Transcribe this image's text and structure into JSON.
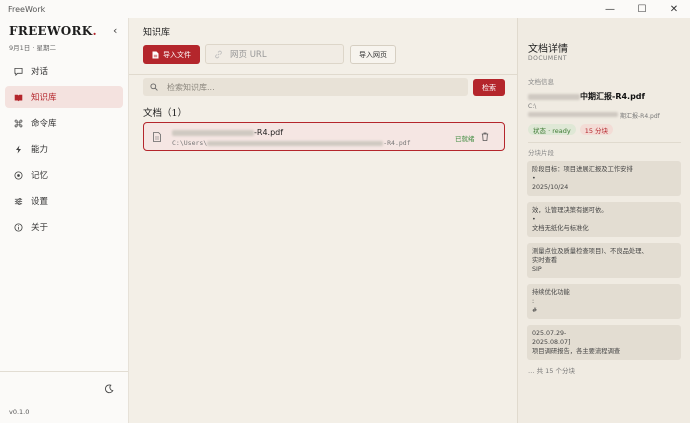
{
  "window": {
    "title": "FreeWork",
    "controls": [
      "—",
      "☐",
      "✕"
    ]
  },
  "sidebar": {
    "brand": "FREEWORK",
    "brand_dot": ".",
    "collapse_glyph": "‹",
    "date": "9月1日 · 星期二",
    "items": [
      {
        "label": "对话",
        "icon": "chat-icon",
        "active": false
      },
      {
        "label": "知识库",
        "icon": "book-icon",
        "active": true
      },
      {
        "label": "命令库",
        "icon": "command-icon",
        "active": false
      },
      {
        "label": "能力",
        "icon": "lightning-icon",
        "active": false
      },
      {
        "label": "记忆",
        "icon": "memory-icon",
        "active": false
      },
      {
        "label": "设置",
        "icon": "sliders-icon",
        "active": false
      },
      {
        "label": "关于",
        "icon": "info-icon",
        "active": false
      }
    ],
    "version": "v0.1.0"
  },
  "main": {
    "title": "知识库",
    "import_file_label": "导入文件",
    "url_placeholder": "网页 URL",
    "import_web_label": "导入网页",
    "search_placeholder": "检索知识库...",
    "search_button": "检索",
    "docs_heading": "文档（1）",
    "doc": {
      "name_suffix": "-R4.pdf",
      "path_prefix": "C:\\Users\\",
      "path_suffix": "-R4.pdf",
      "status": "已就绪"
    }
  },
  "panel": {
    "title": "文档详情",
    "subtitle": "DOCUMENT",
    "info_label": "文档信息",
    "doc_name_suffix": "中期汇报-R4.pdf",
    "path_line1": "C:\\",
    "path_line2": "期汇报-R4.pdf",
    "status_tag": "状态 · ready",
    "chunks_tag": "15 分块",
    "chunks_label": "分块片段",
    "chunks": [
      [
        "阶段目标：项目进展汇报及工作安排",
        "•",
        "2025/10/24"
      ],
      [
        "效，让管理决策有据可依。",
        "•",
        "文档无纸化与标准化"
      ],
      [
        "测量点位及质量检查项目)、不良品处理、",
        "实时查看",
        "SIP"
      ],
      [
        "持续优化功能",
        ":",
        "#"
      ],
      [
        "025.07.29-",
        "2025.08.07]",
        "项目调研报告，各主要流程调查"
      ]
    ],
    "more": "… 共 15 个分块"
  }
}
